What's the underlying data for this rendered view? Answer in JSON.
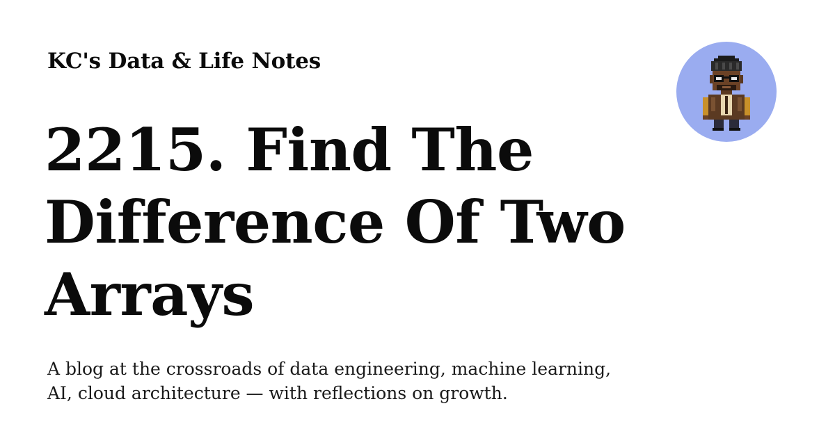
{
  "site": {
    "name": "KC's Data & Life Notes"
  },
  "post": {
    "title": "2215. Find The Difference Of Two Arrays"
  },
  "blog": {
    "tagline": "A blog at the crossroads of data engineering, machine learning, AI, cloud architecture — with reflections on growth."
  },
  "avatar": {
    "icon": "pixel-art-character-icon",
    "background_color": "#9aacf0"
  },
  "colors": {
    "background": "#ffffff",
    "text": "#0b0b0b"
  }
}
